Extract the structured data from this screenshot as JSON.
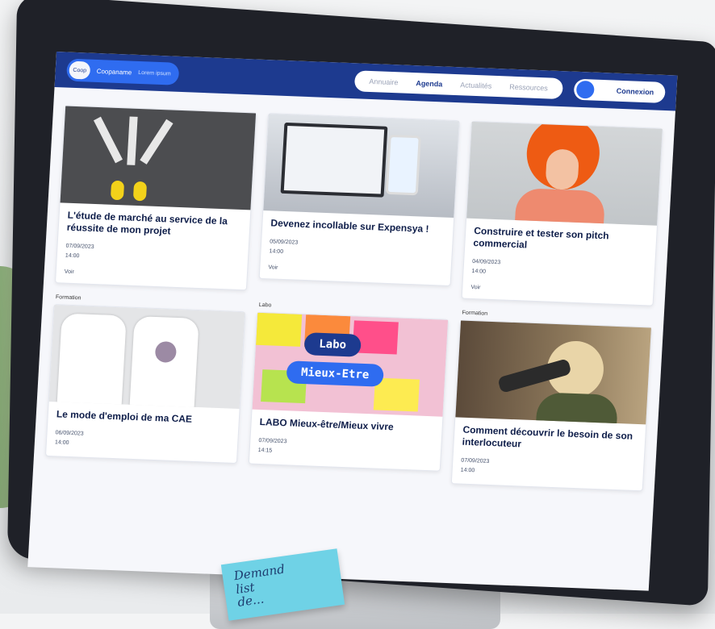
{
  "sticky_note": {
    "line1": "Demand",
    "line2": "list",
    "line3": "de..."
  },
  "navbar": {
    "brand": {
      "logo_text": "Coop",
      "name": "Coopaname",
      "sub": "Lorem ipsum"
    },
    "links": [
      "Annuaire",
      "Agenda",
      "Actualités",
      "Ressources"
    ],
    "active_link": "Agenda",
    "connect_label": "Connexion"
  },
  "cards": [
    {
      "tag": "",
      "title": "L'étude de marché au service de la réussite de mon projet",
      "date": "07/09/2023",
      "time": "14:00",
      "more": "Voir"
    },
    {
      "tag": "",
      "title": "Devenez incollable sur Expensya !",
      "date": "05/09/2023",
      "time": "14:00",
      "more": "Voir"
    },
    {
      "tag": "",
      "title": "Construire et tester son pitch commercial",
      "date": "04/09/2023",
      "time": "14:00",
      "more": "Voir"
    },
    {
      "tag": "Formation",
      "title": "Le mode d'emploi de ma CAE",
      "date": "06/09/2023",
      "time": "14:00",
      "more": ""
    },
    {
      "tag": "Labo",
      "title": "LABO Mieux-être/Mieux vivre",
      "date": "07/09/2023",
      "time": "14:15",
      "more": ""
    },
    {
      "tag": "Formation",
      "title": "Comment découvrir le besoin de son interlocuteur",
      "date": "07/09/2023",
      "time": "14:00",
      "more": ""
    }
  ],
  "labo_image": {
    "line1": "Labo",
    "line2": "Mieux-Etre"
  },
  "colors": {
    "nav_bg": "#1d3a8f",
    "accent": "#2f6cf0",
    "title": "#0f1e4a"
  }
}
